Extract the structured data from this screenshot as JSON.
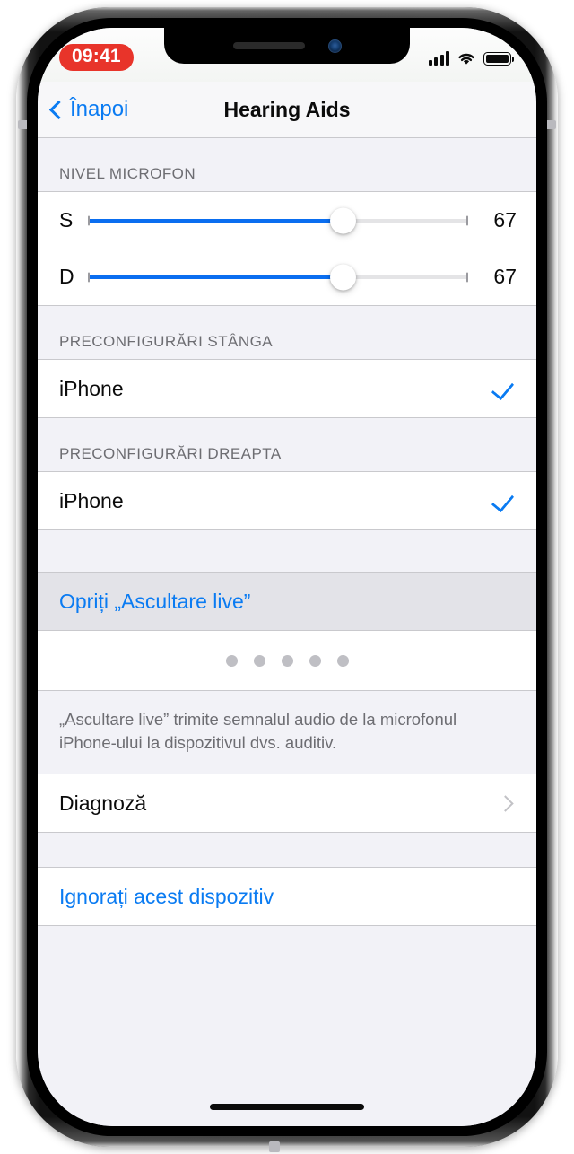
{
  "status_bar": {
    "time": "09:41",
    "time_pill_color": "#e8342a",
    "signal_icon": "cellular-bars-icon",
    "wifi_icon": "wifi-icon",
    "battery_icon": "battery-full-icon"
  },
  "nav": {
    "back_label": "Înapoi",
    "title": "Hearing Aids",
    "accent_color": "#0a7bf2"
  },
  "mic_level": {
    "header": "NIVEL MICROFON",
    "sliders": [
      {
        "channel": "S",
        "value": "67",
        "percent": 67
      },
      {
        "channel": "D",
        "value": "67",
        "percent": 67
      }
    ]
  },
  "presets_left": {
    "header": "PRECONFIGURĂRI STÂNGA",
    "items": [
      {
        "label": "iPhone",
        "selected": true
      }
    ]
  },
  "presets_right": {
    "header": "PRECONFIGURĂRI DREAPTA",
    "items": [
      {
        "label": "iPhone",
        "selected": true
      }
    ]
  },
  "live_listen": {
    "action_label": "Opriți „Ascultare live”",
    "meter_dots": 5,
    "footer": "„Ascultare live” trimite semnalul audio de la microfonul iPhone-ului la dispozitivul dvs. auditiv."
  },
  "diagnostics": {
    "label": "Diagnoză"
  },
  "forget_device": {
    "label": "Ignorați acest dispozitiv"
  }
}
